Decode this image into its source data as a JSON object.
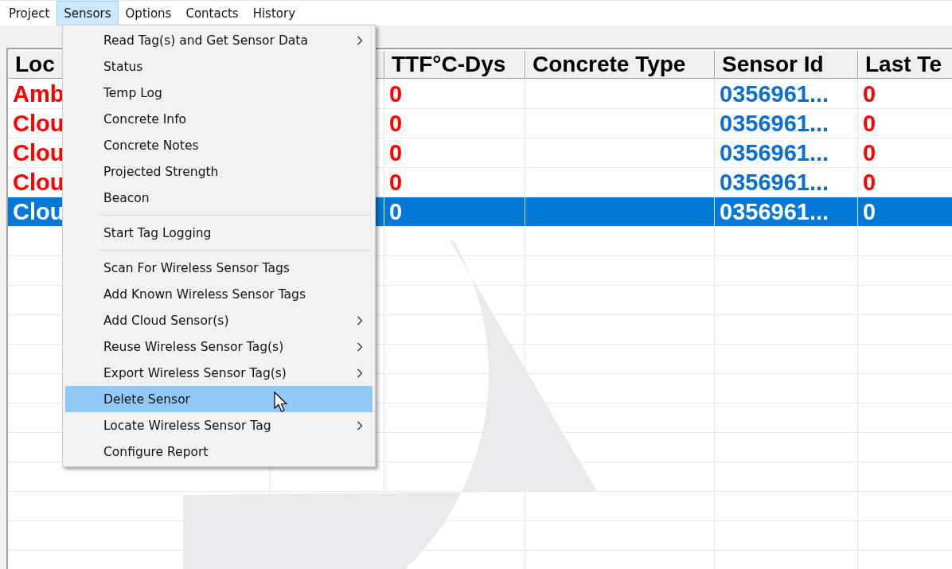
{
  "menu_bar": [
    {
      "label": "Project",
      "selected": false
    },
    {
      "label": "Sensors",
      "selected": true
    },
    {
      "label": "Options",
      "selected": false
    },
    {
      "label": "Contacts",
      "selected": false
    },
    {
      "label": "History",
      "selected": false
    }
  ],
  "table": {
    "columns": [
      {
        "label": "Loc"
      },
      {},
      {
        "label": "TTF°C-Dys"
      },
      {
        "label": "Concrete Type"
      },
      {
        "label": "Sensor Id"
      },
      {
        "label": "Last Te"
      }
    ],
    "rows": [
      {
        "location": "Amb",
        "ttf": "0",
        "concrete_type": "",
        "sensor_id": "0356961...",
        "last_temp": "0",
        "selected": false
      },
      {
        "location": "Clou",
        "ttf": "0",
        "concrete_type": "",
        "sensor_id": "0356961...",
        "last_temp": "0",
        "selected": false
      },
      {
        "location": "Clou",
        "ttf": "0",
        "concrete_type": "",
        "sensor_id": "0356961...",
        "last_temp": "0",
        "selected": false
      },
      {
        "location": "Clou",
        "ttf": "0",
        "concrete_type": "",
        "sensor_id": "0356961...",
        "last_temp": "0",
        "selected": false
      },
      {
        "location": "Clou",
        "ttf": "0",
        "concrete_type": "",
        "sensor_id": "0356961...",
        "last_temp": "0",
        "selected": true
      }
    ]
  },
  "dropdown_menu": {
    "items": [
      {
        "kind": "item",
        "label": "Read Tag(s) and Get Sensor Data",
        "submenu": true,
        "selected": false
      },
      {
        "kind": "item",
        "label": "Status",
        "submenu": false,
        "selected": false
      },
      {
        "kind": "item",
        "label": "Temp Log",
        "submenu": false,
        "selected": false
      },
      {
        "kind": "item",
        "label": "Concrete Info",
        "submenu": false,
        "selected": false
      },
      {
        "kind": "item",
        "label": "Concrete Notes",
        "submenu": false,
        "selected": false
      },
      {
        "kind": "item",
        "label": "Projected Strength",
        "submenu": false,
        "selected": false
      },
      {
        "kind": "item",
        "label": "Beacon",
        "submenu": false,
        "selected": false
      },
      {
        "kind": "separator"
      },
      {
        "kind": "item",
        "label": "Start Tag Logging",
        "submenu": false,
        "selected": false
      },
      {
        "kind": "separator"
      },
      {
        "kind": "item",
        "label": "Scan For Wireless Sensor Tags",
        "submenu": false,
        "selected": false
      },
      {
        "kind": "item",
        "label": "Add Known Wireless Sensor Tags",
        "submenu": false,
        "selected": false
      },
      {
        "kind": "item",
        "label": "Add Cloud Sensor(s)",
        "submenu": true,
        "selected": false
      },
      {
        "kind": "item",
        "label": "Reuse Wireless Sensor Tag(s)",
        "submenu": true,
        "selected": false
      },
      {
        "kind": "item",
        "label": "Export Wireless Sensor Tag(s)",
        "submenu": true,
        "selected": false
      },
      {
        "kind": "item",
        "label": "Delete Sensor",
        "submenu": false,
        "selected": true
      },
      {
        "kind": "item",
        "label": "Locate Wireless Sensor Tag",
        "submenu": true,
        "selected": false
      },
      {
        "kind": "item",
        "label": "Configure Report",
        "submenu": false,
        "selected": false
      }
    ]
  }
}
